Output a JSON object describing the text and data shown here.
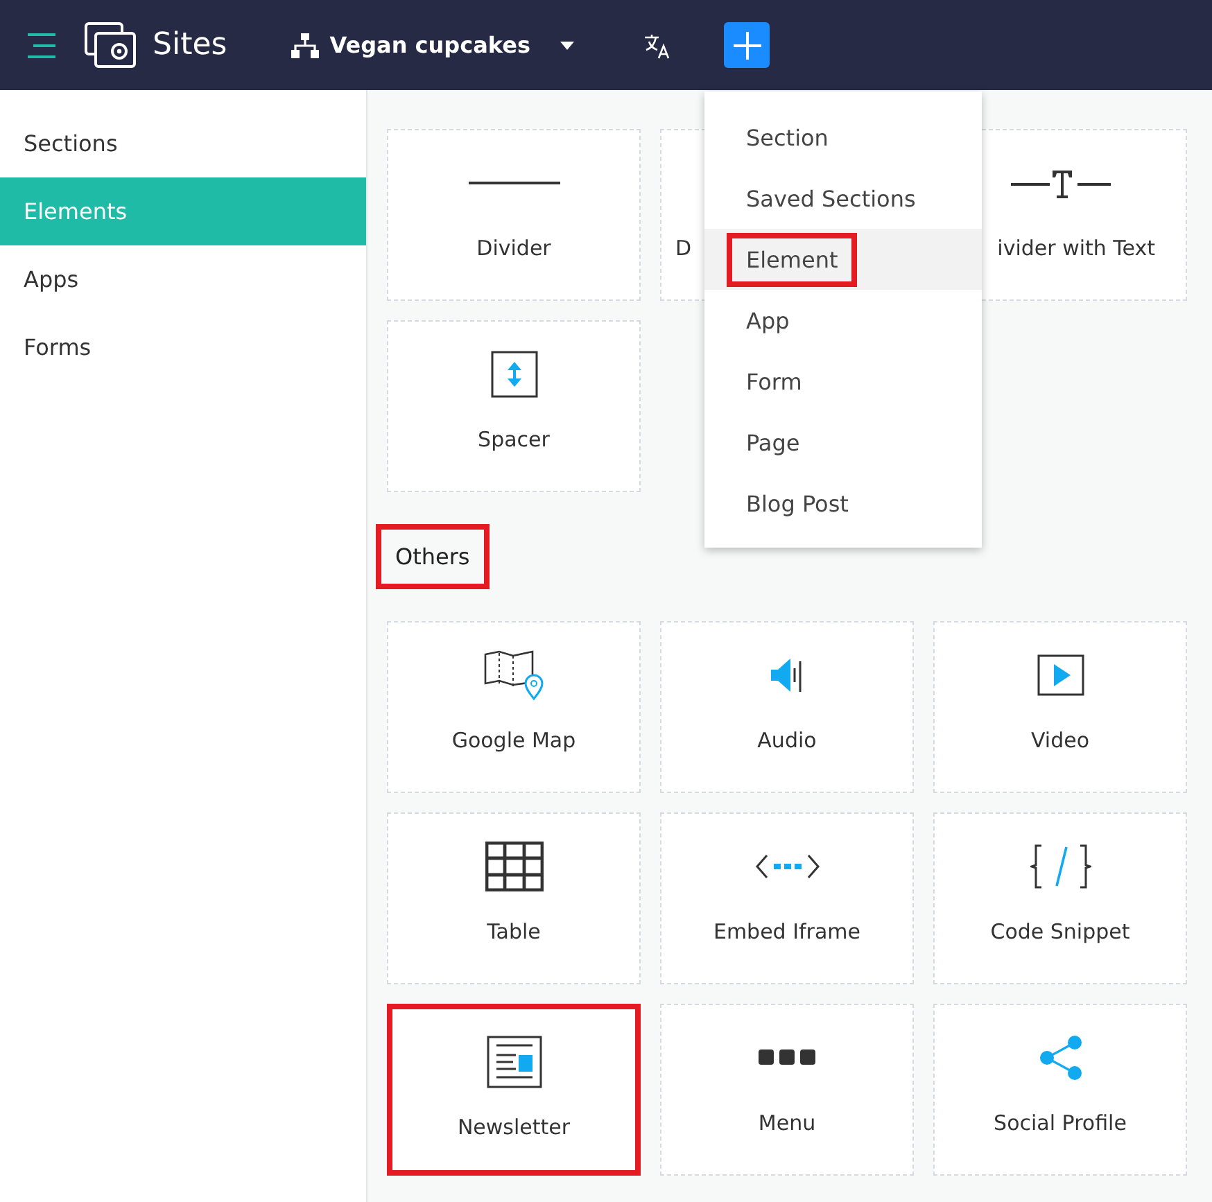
{
  "topbar": {
    "app_name": "Sites",
    "site_name": "Vegan cupcakes"
  },
  "sidebar": {
    "items": [
      {
        "label": "Sections",
        "selected": false
      },
      {
        "label": "Elements",
        "selected": true
      },
      {
        "label": "Apps",
        "selected": false
      },
      {
        "label": "Forms",
        "selected": false
      }
    ]
  },
  "groups": [
    {
      "tiles": [
        {
          "kind": "divider",
          "label": "Divider",
          "highlighted": false
        },
        {
          "kind": "covered",
          "label": "D",
          "highlighted": false
        },
        {
          "kind": "divider-text",
          "label": "ivider with Text",
          "highlighted": false
        },
        {
          "kind": "spacer",
          "label": "Spacer",
          "highlighted": false
        }
      ]
    },
    {
      "heading": "Others",
      "heading_highlighted": true,
      "tiles": [
        {
          "kind": "map",
          "label": "Google Map",
          "highlighted": false
        },
        {
          "kind": "audio",
          "label": "Audio",
          "highlighted": false
        },
        {
          "kind": "video",
          "label": "Video",
          "highlighted": false
        },
        {
          "kind": "table",
          "label": "Table",
          "highlighted": false
        },
        {
          "kind": "iframe",
          "label": "Embed Iframe",
          "highlighted": false
        },
        {
          "kind": "code",
          "label": "Code Snippet",
          "highlighted": false
        },
        {
          "kind": "newsletter",
          "label": "Newsletter",
          "highlighted": true
        },
        {
          "kind": "menu",
          "label": "Menu",
          "highlighted": false
        },
        {
          "kind": "share",
          "label": "Social Profile",
          "highlighted": false
        }
      ]
    }
  ],
  "add_menu": {
    "items": [
      {
        "label": "Section",
        "selected": false,
        "highlighted": false
      },
      {
        "label": "Saved Sections",
        "selected": false,
        "highlighted": false
      },
      {
        "label": "Element",
        "selected": true,
        "highlighted": true
      },
      {
        "label": "App",
        "selected": false,
        "highlighted": false
      },
      {
        "label": "Form",
        "selected": false,
        "highlighted": false
      },
      {
        "label": "Page",
        "selected": false,
        "highlighted": false
      },
      {
        "label": "Blog Post",
        "selected": false,
        "highlighted": false
      }
    ]
  }
}
